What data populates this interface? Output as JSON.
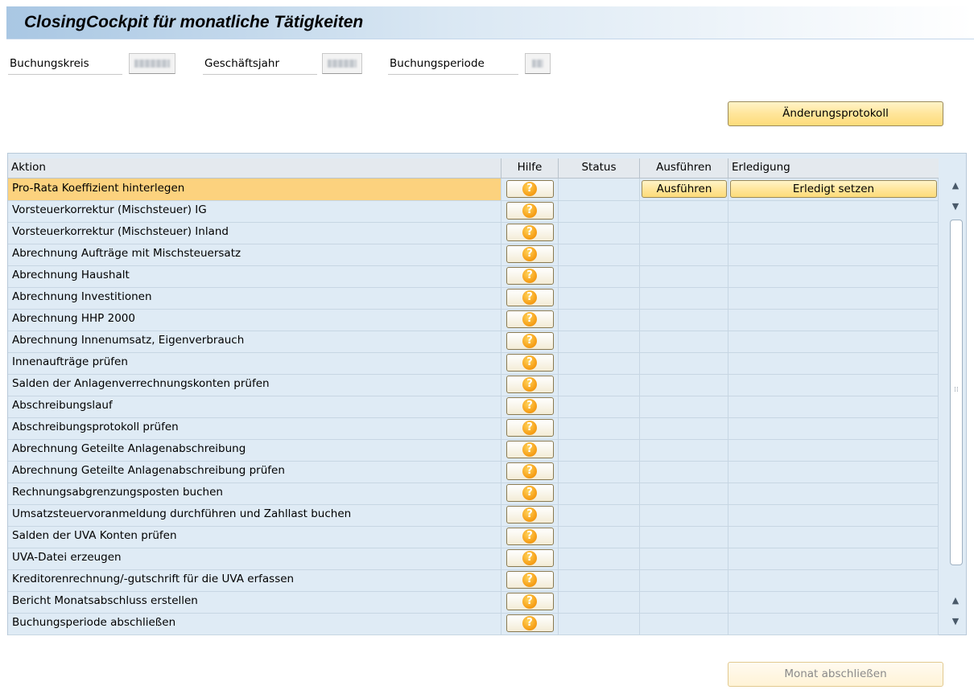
{
  "title": "ClosingCockpit für monatliche Tätigkeiten",
  "header_fields": [
    {
      "label": "Buchungskreis",
      "value": ""
    },
    {
      "label": "Geschäftsjahr",
      "value": ""
    },
    {
      "label": "Buchungsperiode",
      "value": ""
    }
  ],
  "buttons": {
    "change_log": "Änderungsprotokoll",
    "close_month": "Monat abschließen"
  },
  "table": {
    "columns": [
      "Aktion",
      "Hilfe",
      "Status",
      "Ausführen",
      "Erledigung"
    ],
    "rows": [
      {
        "aktion": "Pro-Rata Koeffizient hinterlegen",
        "selected": true,
        "ausfuehren": "Ausführen",
        "erledigung": "Erledigt setzen"
      },
      {
        "aktion": "Vorsteuerkorrektur (Mischsteuer) IG"
      },
      {
        "aktion": "Vorsteuerkorrektur (Mischsteuer) Inland"
      },
      {
        "aktion": "Abrechnung Aufträge mit Mischsteuersatz"
      },
      {
        "aktion": "Abrechnung Haushalt"
      },
      {
        "aktion": "Abrechnung Investitionen"
      },
      {
        "aktion": "Abrechnung HHP 2000"
      },
      {
        "aktion": "Abrechnung Innenumsatz, Eigenverbrauch"
      },
      {
        "aktion": "Innenaufträge prüfen"
      },
      {
        "aktion": "Salden der Anlagenverrechnungskonten prüfen"
      },
      {
        "aktion": "Abschreibungslauf"
      },
      {
        "aktion": "Abschreibungsprotokoll prüfen"
      },
      {
        "aktion": "Abrechnung Geteilte Anlagenabschreibung"
      },
      {
        "aktion": "Abrechnung Geteilte Anlagenabschreibung prüfen"
      },
      {
        "aktion": "Rechnungsabgrenzungsposten buchen"
      },
      {
        "aktion": "Umsatzsteuervoranmeldung durchführen und Zahllast buchen"
      },
      {
        "aktion": "Salden der UVA Konten prüfen"
      },
      {
        "aktion": "UVA-Datei erzeugen"
      },
      {
        "aktion": "Kreditorenrechnung/-gutschrift für die UVA erfassen"
      },
      {
        "aktion": "Bericht Monatsabschluss erstellen"
      },
      {
        "aktion": "Buchungsperiode abschließen"
      }
    ]
  },
  "icons": {
    "help": "?",
    "scroll_up": "▲",
    "scroll_down": "▼"
  },
  "colors": {
    "title_gradient": "#a9c7e3",
    "table_bg": "#dfebf5",
    "selected_row": "#fcd27e",
    "button_yellow": "#ffe59a"
  }
}
